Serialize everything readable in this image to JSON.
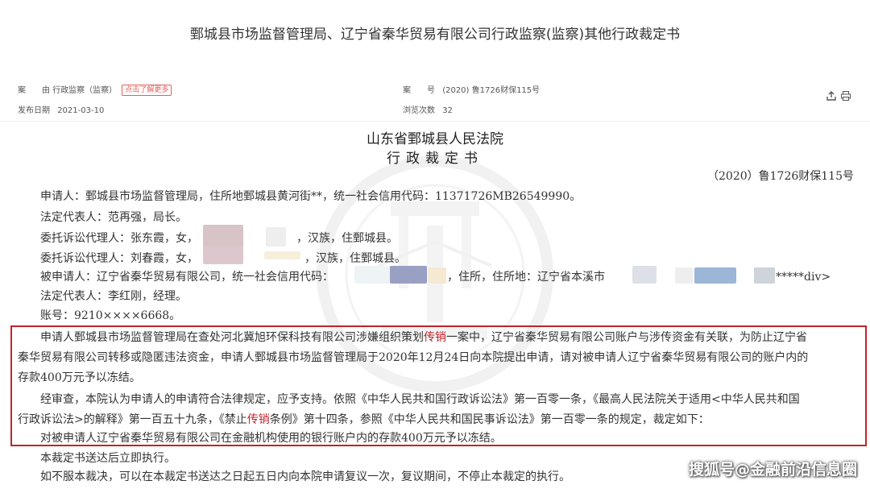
{
  "header": {
    "title": "鄄城县市场监督管理局、辽宁省秦华贸易有限公司行政监察(监察)其他行政裁定书",
    "cause_label": "案　　由",
    "cause_value": "行政监察（监察）",
    "learn_more": "点击了解更多",
    "case_no_label": "案　　号",
    "case_no_value": "(2020) 鲁1726财保115号",
    "publish_label": "发布日期",
    "publish_value": "2021-03-10",
    "views_label": "浏览次数",
    "views_value": "32",
    "share_icon": "share-icon",
    "print_icon": "print-icon"
  },
  "document": {
    "court": "山东省鄄城县人民法院",
    "doc_type": "行政裁定书",
    "case_number": "（2020）鲁1726财保115号",
    "lines": [
      "申请人：鄄城县市场监督管理局，住所地鄄城县黄河街**，统一社会信用代码：11371726MB26549990。",
      "法定代表人：范再强，局长。",
      "委托诉讼代理人：张东霞，女，",
      "，汉族，住鄄城县。",
      "委托诉讼代理人：刘春霞，女，",
      "，汉族，住鄄城县。",
      "被申请人：辽宁省秦华贸易有限公司，统一社会信用代码：",
      "，住所，住所地：辽宁省本溪市",
      "*****div>",
      "法定代表人：李红刚，经理。",
      "账号：9210××××6668。"
    ],
    "para1_a": "申请人鄄城县市场监督管理局在查处河北冀旭环保科技有限公司涉嫌组织策划",
    "para1_hl": "传销",
    "para1_b": "一案中，辽宁省秦华贸易有限公司账户与涉传资金有关联，为防止辽宁省",
    "para1_line2": "秦华贸易有限公司转移或隐匿违法资金，申请人鄄城县市场监督管理局于2020年12月24日向本院提出申请，请对被申请人辽宁省秦华贸易有限公司的账户内的",
    "para1_line3": "存款400万元予以冻结。",
    "para2_line1": "经审查，本院认为申请人的申请符合法律规定，应予支持。依照《中华人民共和国行政诉讼法》第一百零一条，《最高人民法院关于适用<中华人民共和国",
    "para2_line2_a": "行政诉讼法>的解释》第一百五十九条，《禁止",
    "para2_line2_hl": "传销",
    "para2_line2_b": "条例》第十四条，参照《中华人民共和国民事诉讼法》第一百零一条的规定，裁定如下：",
    "ruling": "对被申请人辽宁省秦华贸易有限公司在金融机构使用的银行账户内的存款400万元予以冻结。",
    "effect": "本裁定书送达后立即执行。",
    "appeal": "如不服本裁决，可以在本裁定书送达之日起五日内向本院申请复议一次，复议期间，不停止本裁定的执行。"
  },
  "watermark": "搜狐号@金融前沿信息圈",
  "colors": {
    "highlight": "#c0242a",
    "badge": "#e0615c"
  }
}
